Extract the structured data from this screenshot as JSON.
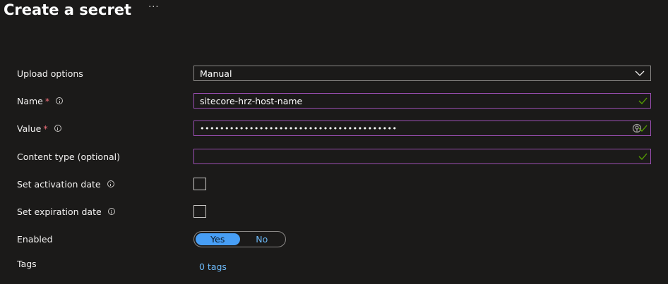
{
  "header": {
    "title": "Create a secret",
    "more_label": "···"
  },
  "form": {
    "upload_options": {
      "label": "Upload options",
      "value": "Manual"
    },
    "name": {
      "label": "Name",
      "required_mark": "*",
      "value": "sitecore-hrz-host-name"
    },
    "value": {
      "label": "Value",
      "required_mark": "*",
      "masked_value": "••••••••••••••••••••••••••••••••••••••••"
    },
    "content_type": {
      "label": "Content type (optional)",
      "value": ""
    },
    "activation_date": {
      "label": "Set activation date",
      "checked": false
    },
    "expiration_date": {
      "label": "Set expiration date",
      "checked": false
    },
    "enabled": {
      "label": "Enabled",
      "yes_label": "Yes",
      "no_label": "No",
      "selected": "Yes"
    },
    "tags": {
      "label": "Tags",
      "link_label": "0 tags"
    }
  },
  "colors": {
    "background": "#1b1a19",
    "valid_border": "#9b4fb3",
    "check_green": "#57a300",
    "link_blue": "#6cb8f6",
    "toggle_active": "#479ef5",
    "required_red": "#f1707b"
  }
}
